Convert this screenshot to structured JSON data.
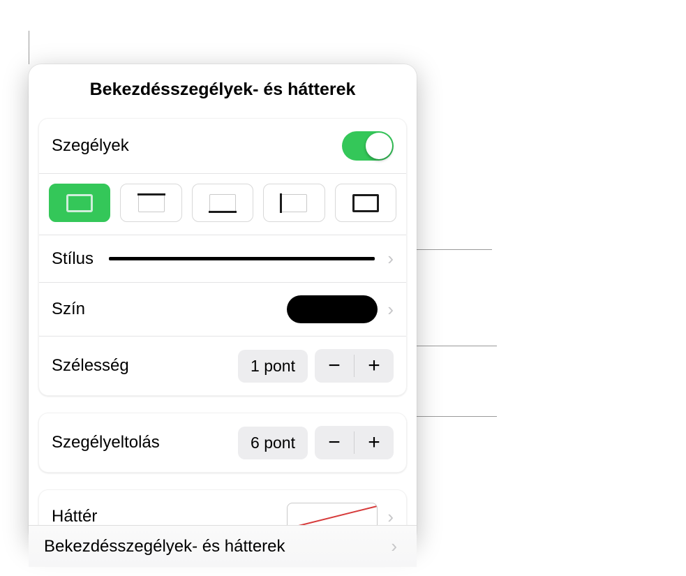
{
  "header": {
    "title": "Bekezdésszegélyek- és hátterek"
  },
  "borders": {
    "toggle_label": "Szegélyek",
    "toggle_on": true,
    "positions": [
      "full",
      "top",
      "bottom",
      "left",
      "right"
    ],
    "selected_position": "full",
    "style_label": "Stílus",
    "color_label": "Szín",
    "color_value": "#000000",
    "width_label": "Szélesség",
    "width_value": "1 pont"
  },
  "offset": {
    "label": "Szegélyeltolás",
    "value": "6 pont"
  },
  "background": {
    "label": "Háttér",
    "value": "none"
  },
  "footer": {
    "label": "Bekezdésszegélyek- és hátterek"
  },
  "icons": {
    "chevron": "›",
    "minus": "−",
    "plus": "+"
  }
}
